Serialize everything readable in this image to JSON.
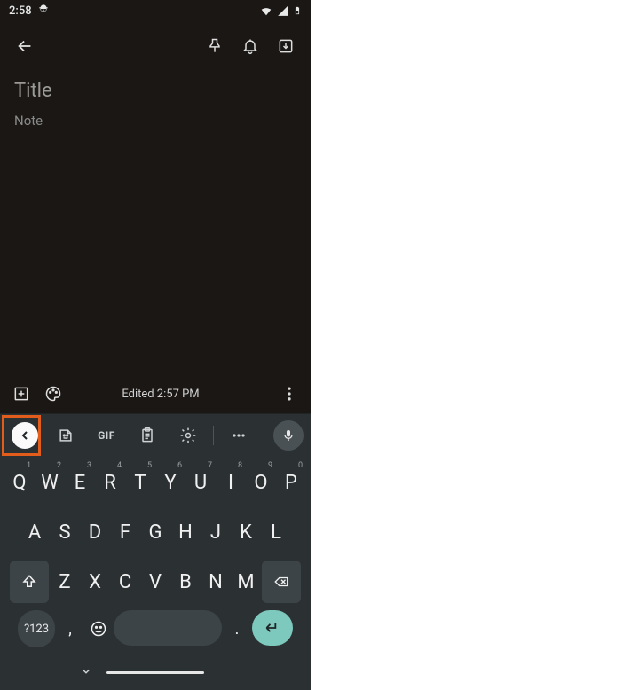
{
  "status": {
    "time": "2:58",
    "incognito_icon": "incognito"
  },
  "toolbar": {
    "back": "arrow-back",
    "pin": "pushpin",
    "reminder": "bell-plus",
    "archive": "archive"
  },
  "note": {
    "title_value": "",
    "title_placeholder": "Title",
    "body_value": "",
    "body_placeholder": "Note"
  },
  "bottom": {
    "add": "add-box",
    "palette": "palette",
    "edited": "Edited 2:57 PM",
    "more": "more-vert"
  },
  "keyboard": {
    "toolbar": {
      "chevron": "<",
      "sticker": "sticker",
      "gif": "GIF",
      "clipboard": "clipboard",
      "settings": "gear",
      "more": "more-horiz",
      "mic": "mic"
    },
    "rows": {
      "r1": [
        {
          "k": "Q",
          "s": "1"
        },
        {
          "k": "W",
          "s": "2"
        },
        {
          "k": "E",
          "s": "3"
        },
        {
          "k": "R",
          "s": "4"
        },
        {
          "k": "T",
          "s": "5"
        },
        {
          "k": "Y",
          "s": "6"
        },
        {
          "k": "U",
          "s": "7"
        },
        {
          "k": "I",
          "s": "8"
        },
        {
          "k": "O",
          "s": "9"
        },
        {
          "k": "P",
          "s": "0"
        }
      ],
      "r2": [
        "A",
        "S",
        "D",
        "F",
        "G",
        "H",
        "J",
        "K",
        "L"
      ],
      "r3": [
        "Z",
        "X",
        "C",
        "V",
        "B",
        "N",
        "M"
      ]
    },
    "bottom": {
      "symbols": "?123",
      "comma": ",",
      "period": "."
    }
  }
}
